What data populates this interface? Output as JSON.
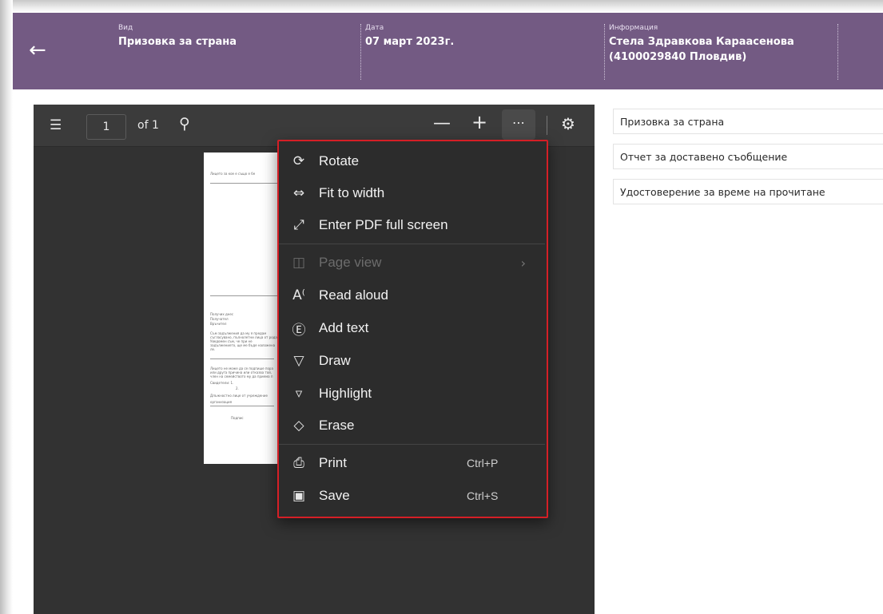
{
  "header": {
    "back_icon": "arrow-left-icon",
    "col1": {
      "label": "Вид",
      "value": "Призовка за страна"
    },
    "col2": {
      "label": "Дата",
      "value": "07 март 2023г."
    },
    "col3": {
      "label": "Информация",
      "value": "Стела Здравкова Караасенова (4100029840 Пловдив)"
    },
    "color": "#735a83"
  },
  "viewer": {
    "toolbar": {
      "contents_icon": "list-icon",
      "page_number": "1",
      "page_of": "of 1",
      "search_icon": "search-icon",
      "zoom_out_icon": "minus-icon",
      "zoom_in_icon": "plus-icon",
      "more_icon": "more-horizontal-icon",
      "settings_icon": "gear-icon"
    },
    "page_lines": [
      "Лицето за кое е също е бе",
      "Получих днес",
      "Получател",
      "Връчител",
      "Съм задължения да му я предам",
      "съгласувано, пълнолетни лица от рода",
      "Уведомен съм, че при не",
      "задължението, ще ме бъде наложена",
      "ле.",
      "Лицето не може да се подпише пора",
      "или друга причина или отказва той,",
      "член на семейството му да приема п",
      "Свидетели: 1.",
      "2.",
      "Длъжностно лице от учреждение",
      "организация",
      "Подпис"
    ],
    "menu": {
      "items": [
        {
          "label": "Rotate",
          "icon": "rotate-icon"
        },
        {
          "label": "Fit to width",
          "icon": "fit-width-icon"
        },
        {
          "label": "Enter PDF full screen",
          "icon": "expand-icon"
        },
        {
          "label": "Page view",
          "icon": "page-view-icon",
          "disabled": true
        },
        {
          "label": "Read aloud",
          "icon": "read-aloud-icon"
        },
        {
          "label": "Add text",
          "icon": "add-text-icon"
        },
        {
          "label": "Draw",
          "icon": "draw-icon"
        },
        {
          "label": "Highlight",
          "icon": "highlight-icon"
        },
        {
          "label": "Erase",
          "icon": "eraser-icon"
        },
        {
          "label": "Print",
          "icon": "print-icon",
          "shortcut": "Ctrl+P"
        },
        {
          "label": "Save",
          "icon": "save-icon",
          "shortcut": "Ctrl+S"
        }
      ],
      "highlight_color": "#d51f26"
    }
  },
  "documents": [
    "Призовка за страна",
    "Отчет за доставено съобщение",
    "Удостоверение за време на прочитане"
  ]
}
